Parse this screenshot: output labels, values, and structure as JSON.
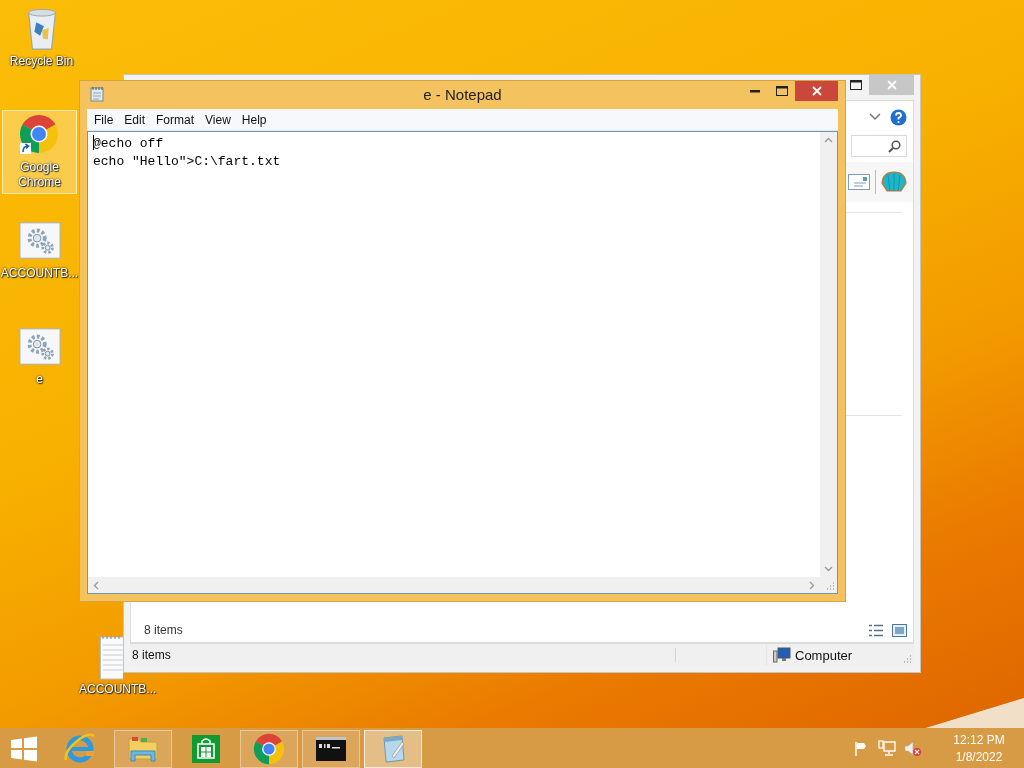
{
  "desktop_icons": [
    {
      "label": "Recycle Bin",
      "kind": "recycle",
      "selected": false
    },
    {
      "label": "Google Chrome",
      "kind": "chrome",
      "selected": true
    },
    {
      "label": "ACCOUNTB...",
      "kind": "script",
      "selected": false
    },
    {
      "label": "e",
      "kind": "script",
      "selected": false
    },
    {
      "label": "ACCOUNTB...",
      "kind": "textfile",
      "selected": false
    }
  ],
  "explorer": {
    "items_count": "8 items",
    "status_items": "8 items",
    "location": "Computer"
  },
  "notepad": {
    "title": "e - Notepad",
    "menu": [
      "File",
      "Edit",
      "Format",
      "View",
      "Help"
    ],
    "lines": [
      "@echo off",
      "echo \"Hello\">C:\\fart.txt"
    ]
  },
  "taskbar": {
    "apps": [
      {
        "kind": "ie",
        "running": false,
        "selected": false
      },
      {
        "kind": "explorer",
        "running": true,
        "selected": false
      },
      {
        "kind": "store",
        "running": false,
        "selected": false
      },
      {
        "kind": "chrome",
        "running": true,
        "selected": false
      },
      {
        "kind": "cmd",
        "running": true,
        "selected": false
      },
      {
        "kind": "notepad",
        "running": true,
        "selected": true
      }
    ],
    "volume_muted": true,
    "clock": {
      "time": "12:12 PM",
      "date": "1/8/2022"
    }
  }
}
